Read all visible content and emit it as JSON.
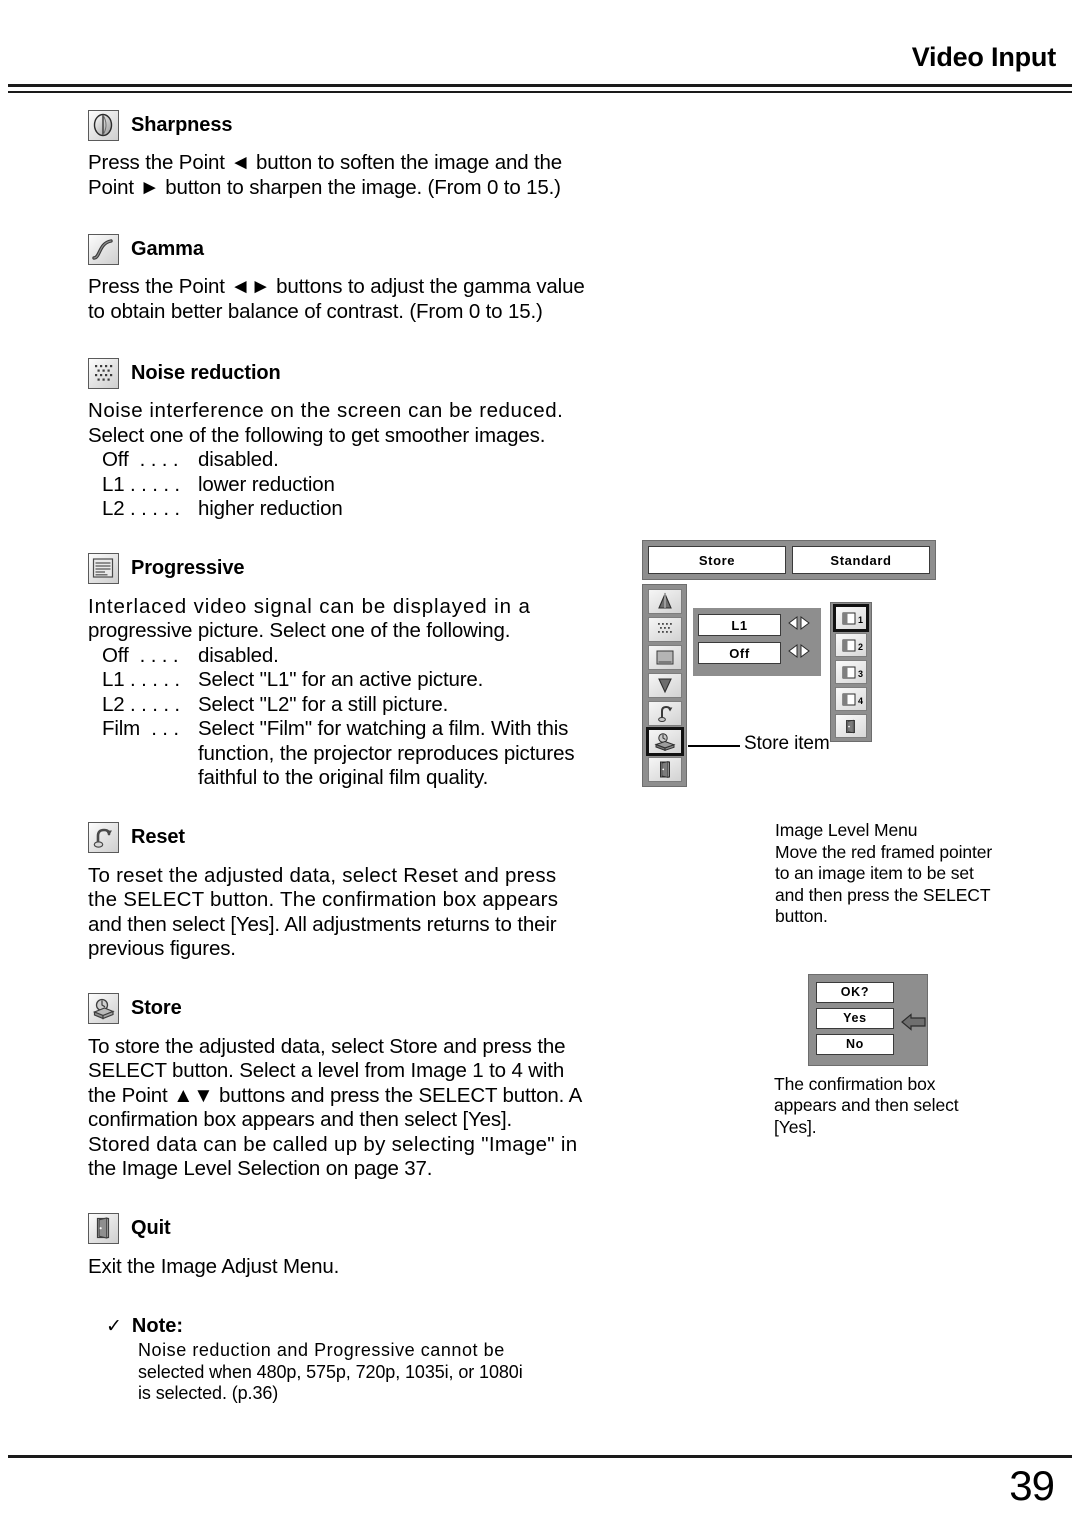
{
  "header": {
    "title": "Video Input"
  },
  "sections": [
    {
      "id": "sharpness",
      "icon": "sharpness-sphere-icon",
      "title": "Sharpness",
      "paragraphs": [
        "Press the Point ◄ button to soften the image and the",
        "Point ► button to sharpen the image. (From 0 to 15.)"
      ]
    },
    {
      "id": "gamma",
      "icon": "gamma-curve-icon",
      "title": "Gamma",
      "paragraphs": [
        "Press the Point ◄► buttons to adjust the gamma value",
        "to obtain better balance of contrast. (From 0 to 15.)"
      ]
    },
    {
      "id": "noise-reduction",
      "icon": "noise-dots-icon",
      "title": "Noise  reduction",
      "paragraphs": [
        "Noise interference on the screen can be reduced.",
        "Select one of the following to get smoother images."
      ],
      "options": [
        {
          "key": "Off  . . . .",
          "value": "disabled."
        },
        {
          "key": "L1 . . . . .",
          "value": "lower reduction"
        },
        {
          "key": "L2 . . . . .",
          "value": "higher reduction"
        }
      ]
    },
    {
      "id": "progressive",
      "icon": "progressive-screen-icon",
      "title": "Progressive",
      "paragraphs": [
        "Interlaced video signal can be displayed in a",
        "progressive picture.  Select one of the following."
      ],
      "options": [
        {
          "key": "Off  . . . .",
          "value": "disabled."
        },
        {
          "key": "L1 . . . . .",
          "value": "Select \"L1\" for an active picture."
        },
        {
          "key": "L2 . . . . .",
          "value": "Select \"L2\" for a still picture."
        },
        {
          "key": "Film  . . .",
          "value": "Select \"Film\" for watching a film. With this",
          "continuation": [
            "function, the projector reproduces pictures",
            "faithful to the original film quality."
          ]
        }
      ]
    },
    {
      "id": "reset",
      "icon": "reset-arrow-icon",
      "title": "Reset",
      "paragraphs": [
        "To reset the adjusted data, select Reset and press",
        "the SELECT button.  The confirmation box appears",
        "and then select [Yes].  All adjustments returns to their",
        "previous figures."
      ]
    },
    {
      "id": "store",
      "icon": "store-disk-icon",
      "title": "Store",
      "paragraphs": [
        "To store the adjusted data, select Store and press the",
        "SELECT button.  Select a level from Image 1 to 4 with",
        "the Point ▲▼ buttons and press the SELECT button.  A",
        "confirmation box appears and then select [Yes].",
        "Stored data can be called up by selecting \"Image\" in",
        "the Image Level Selection on page 37."
      ]
    },
    {
      "id": "quit",
      "icon": "quit-door-icon",
      "title": "Quit",
      "paragraphs": [
        "Exit the Image Adjust Menu."
      ]
    }
  ],
  "note": {
    "check": "✓",
    "title": "Note:",
    "lines": [
      "Noise reduction and Progressive cannot be",
      "selected when 480p, 575p, 720p, 1035i, or 1080i",
      "is selected. (p.36)"
    ]
  },
  "osd": {
    "tabs": [
      {
        "label": "Store"
      },
      {
        "label": "Standard"
      }
    ],
    "left_icons": [
      {
        "name": "sharpness-icon",
        "selected": false
      },
      {
        "name": "noise-reduction-icon",
        "selected": false
      },
      {
        "name": "progressive-icon",
        "selected": false
      },
      {
        "name": "gamma-icon",
        "selected": false
      },
      {
        "name": "reset-icon",
        "selected": false
      },
      {
        "name": "store-icon",
        "selected": true
      },
      {
        "name": "quit-icon",
        "selected": false
      }
    ],
    "values": [
      {
        "label": "L1"
      },
      {
        "label": "Off"
      }
    ],
    "image_levels": [
      {
        "label": "1",
        "selected": true
      },
      {
        "label": "2",
        "selected": false
      },
      {
        "label": "3",
        "selected": false
      },
      {
        "label": "4",
        "selected": false
      }
    ],
    "store_item_label": "Store item",
    "caption": [
      "Image Level Menu",
      "Move the red framed pointer",
      "to an image item to be set",
      "and then press the SELECT",
      "button."
    ]
  },
  "confirm": {
    "buttons": [
      {
        "label": "OK?"
      },
      {
        "label": "Yes"
      },
      {
        "label": "No"
      }
    ],
    "caption": [
      "The confirmation box",
      "appears and then select",
      "[Yes]."
    ]
  },
  "footer": {
    "page_number": "39"
  }
}
